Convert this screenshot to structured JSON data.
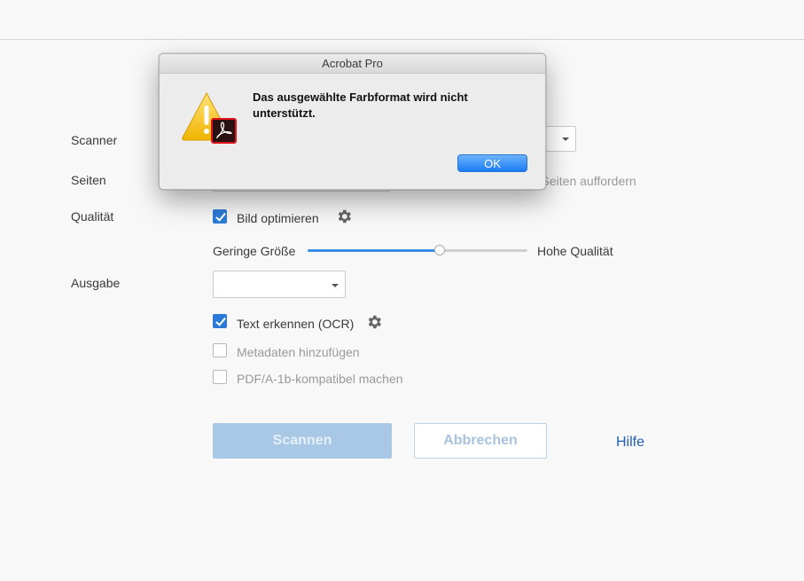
{
  "form": {
    "scanner_label": "Scanner",
    "pages_label": "Seiten",
    "pages_prompt_partial": "r Seiten auffordern",
    "quality_label": "Qualität",
    "optimize_image": {
      "label": "Bild optimieren",
      "checked": true
    },
    "slider": {
      "min_label": "Geringe Größe",
      "max_label": "Hohe Qualität",
      "value_fraction": 0.6
    },
    "output_label": "Ausgabe",
    "output_select_value": "",
    "ocr": {
      "label": "Text erkennen (OCR)",
      "checked": true
    },
    "metadata": {
      "label": "Metadaten hinzufügen",
      "checked": false
    },
    "pdfa": {
      "label": "PDF/A-1b-kompatibel machen",
      "checked": false
    }
  },
  "actions": {
    "scan_label": "Scannen",
    "cancel_label": "Abbrechen",
    "help_label": "Hilfe"
  },
  "dialog": {
    "title": "Acrobat Pro",
    "message": "Das ausgewählte Farbformat wird nicht unterstützt.",
    "ok_label": "OK",
    "icon": "warning-acrobat-icon"
  },
  "colors": {
    "accent": "#2d7ad6",
    "link": "#2260b6",
    "ok_button": "#1b7bf5"
  }
}
